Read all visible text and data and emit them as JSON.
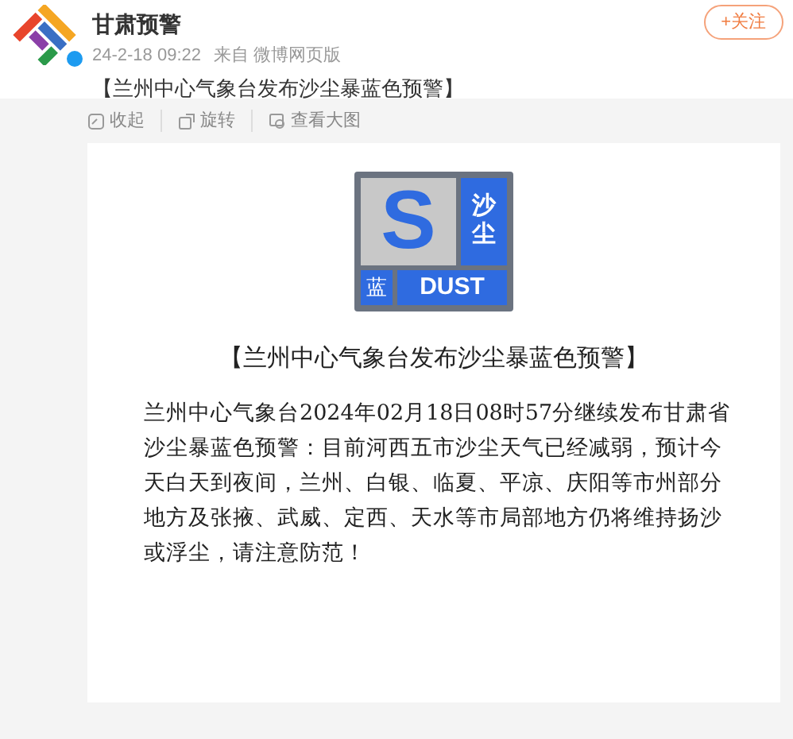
{
  "post": {
    "author": "甘肃预警",
    "verified": true,
    "time": "24-2-18 09:22",
    "source": "来自 微博网页版",
    "follow_button": "+关注",
    "text": "【兰州中心气象台发布沙尘暴蓝色预警】"
  },
  "toolbar": [
    {
      "kind": "collapse",
      "label": "收起"
    },
    {
      "kind": "rotate",
      "label": "旋转"
    },
    {
      "kind": "view",
      "label": "查看大图"
    }
  ],
  "image": {
    "sign": {
      "letter": "S",
      "type": "沙尘",
      "level": "蓝",
      "type_en": "DUST"
    },
    "heading": "【兰州中心气象台发布沙尘暴蓝色预警】",
    "body": "兰州中心气象台2024年02月18日08时57分继续发布甘肃省沙尘暴蓝色预警：目前河西五市沙尘天气已经减弱，预计今天白天到夜间，兰州、白银、临夏、平凉、庆阳等市州部分地方及张掖、武威、定西、天水等市局部地方仍将维持扬沙或浮尘，请注意防范！"
  }
}
